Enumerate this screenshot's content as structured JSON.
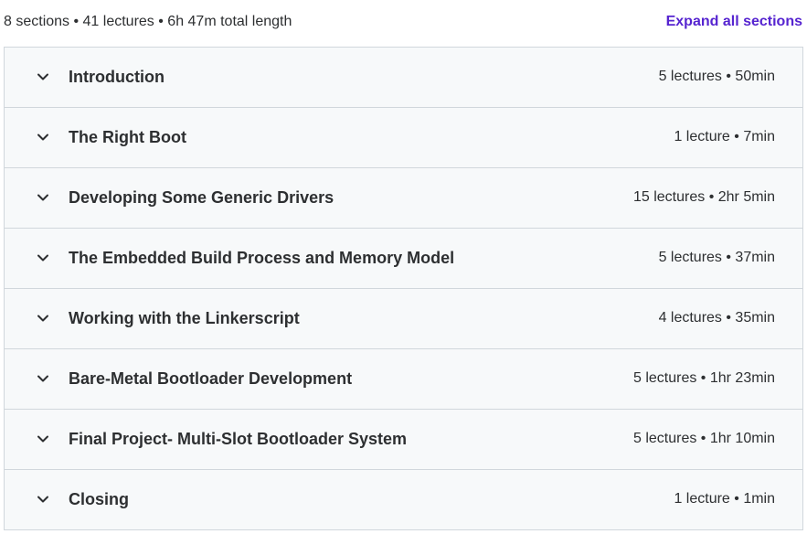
{
  "summary": {
    "text": "8 sections • 41 lectures • 6h 47m total length",
    "expand_label": "Expand all sections"
  },
  "sections": [
    {
      "title": "Introduction",
      "meta": "5 lectures • 50min"
    },
    {
      "title": "The Right Boot",
      "meta": "1 lecture • 7min"
    },
    {
      "title": "Developing Some Generic Drivers",
      "meta": "15 lectures • 2hr 5min"
    },
    {
      "title": "The Embedded Build Process and Memory Model",
      "meta": "5 lectures • 37min"
    },
    {
      "title": "Working with the Linkerscript",
      "meta": "4 lectures • 35min"
    },
    {
      "title": "Bare-Metal Bootloader Development",
      "meta": "5 lectures • 1hr 23min"
    },
    {
      "title": "Final Project- Multi-Slot Bootloader System",
      "meta": "5 lectures • 1hr 10min"
    },
    {
      "title": "Closing",
      "meta": "1 lecture • 1min"
    }
  ],
  "icons": {
    "section_toggle": "chevron-down-icon"
  },
  "colors": {
    "accent": "#5624d0",
    "section_background": "#f7f9fa",
    "border": "#d1d7dc",
    "text": "#2d2f31"
  }
}
